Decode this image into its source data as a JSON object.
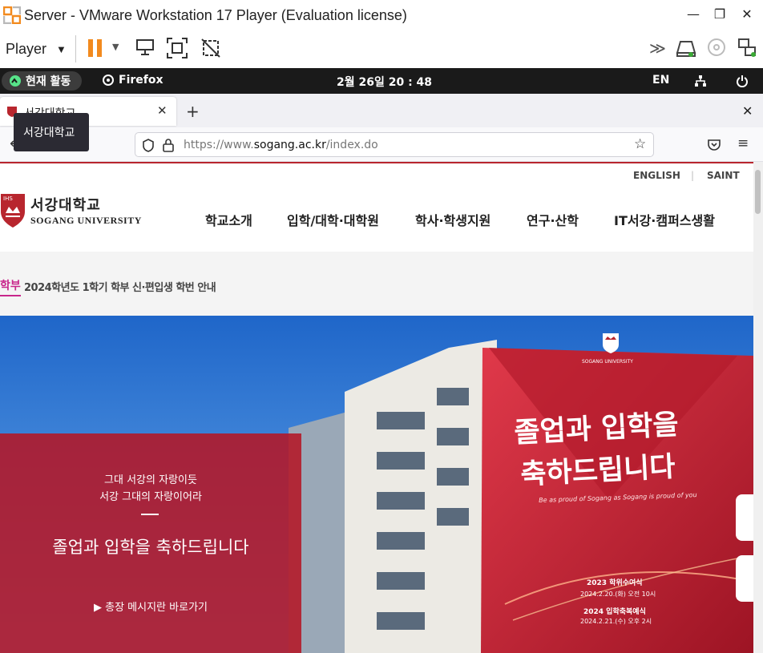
{
  "vmware": {
    "title": "Server - VMware Workstation 17 Player (Evaluation license)",
    "player_menu": "Player",
    "brand_color": "#f28a1e"
  },
  "gnome": {
    "activities": "현재 활동",
    "app": "Firefox",
    "clock": "2월 26일  20 : 48",
    "lang": "EN"
  },
  "firefox": {
    "tab_title": "서강대학교",
    "tooltip": "서강대학교",
    "url_scheme": "https://www.",
    "url_host": "sogang.ac.kr",
    "url_path": "/index.do"
  },
  "site": {
    "util_links": [
      "ENGLISH",
      "SAINT"
    ],
    "logo_kr": "서강대학교",
    "logo_en": "SOGANG UNIVERSITY",
    "nav": [
      "학교소개",
      "입학/대학·대학원",
      "학사·학생지원",
      "연구·산학",
      "IT서강·캠퍼스생활"
    ],
    "notice_category": "학부",
    "notice_text": "2024학년도 1학기 학부 신·편입생 학번 안내",
    "hero_sub_1": "그대 서강의 자랑이듯",
    "hero_sub_2": "서강 그대의 자랑이어라",
    "hero_title": "졸업과 입학을 축하드립니다",
    "hero_link": "▶ 총장 메시지란 바로가기",
    "banner_title_1": "졸업과 입학을",
    "banner_title_2": "축하드립니다",
    "banner_tagline": "Be as proud of Sogang as Sogang is proud of you",
    "banner_brand": "SOGANG UNIVERSITY",
    "banner_event_1": "2023 학위수여식",
    "banner_event_1_date": "2024.2.20.(화) 오전 10시",
    "banner_event_2": "2024 입학축복예식",
    "banner_event_2_date": "2024.2.21.(수) 오후 2시",
    "accent": "#b8262e"
  }
}
